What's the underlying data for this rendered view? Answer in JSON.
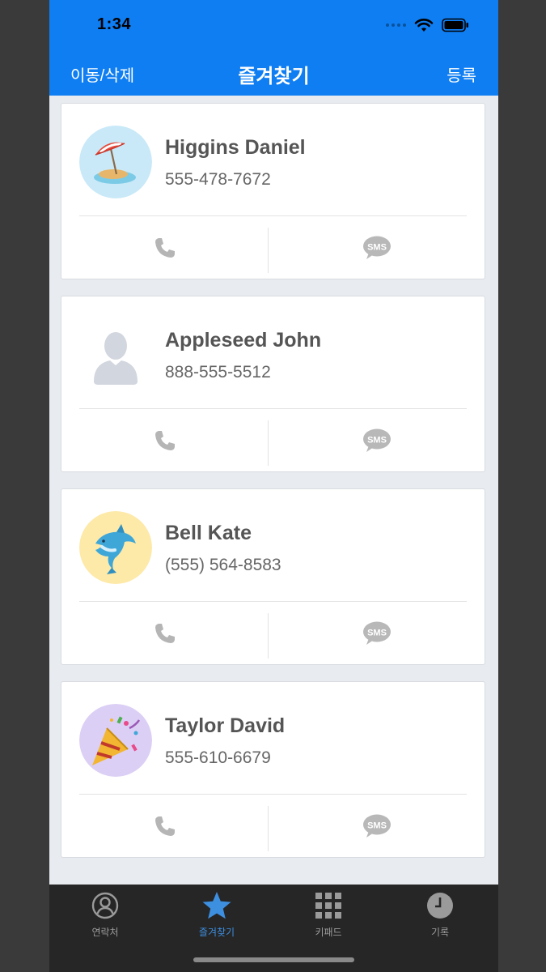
{
  "status": {
    "time": "1:34"
  },
  "nav": {
    "left": "이동/삭제",
    "title": "즐겨찾기",
    "right": "등록"
  },
  "colors": {
    "nav_bg": "#0f7ef2",
    "tab_active": "#3d8fe0",
    "tab_inactive": "#9a9a9a"
  },
  "contacts": [
    {
      "name": "Higgins Daniel",
      "phone": "555-478-7672",
      "avatar": "beach-umbrella-emoji"
    },
    {
      "name": "Appleseed John",
      "phone": "888-555-5512",
      "avatar": "default-person-silhouette"
    },
    {
      "name": "Bell Kate",
      "phone": "(555) 564-8583",
      "avatar": "dolphin-emoji"
    },
    {
      "name": "Taylor David",
      "phone": "555-610-6679",
      "avatar": "party-popper-emoji"
    }
  ],
  "actions": {
    "sms_label": "SMS"
  },
  "tabs": [
    {
      "label": "연락처",
      "icon": "person-circle-icon"
    },
    {
      "label": "즐겨찾기",
      "icon": "star-icon"
    },
    {
      "label": "키패드",
      "icon": "keypad-grid-icon"
    },
    {
      "label": "기록",
      "icon": "clock-icon"
    }
  ]
}
